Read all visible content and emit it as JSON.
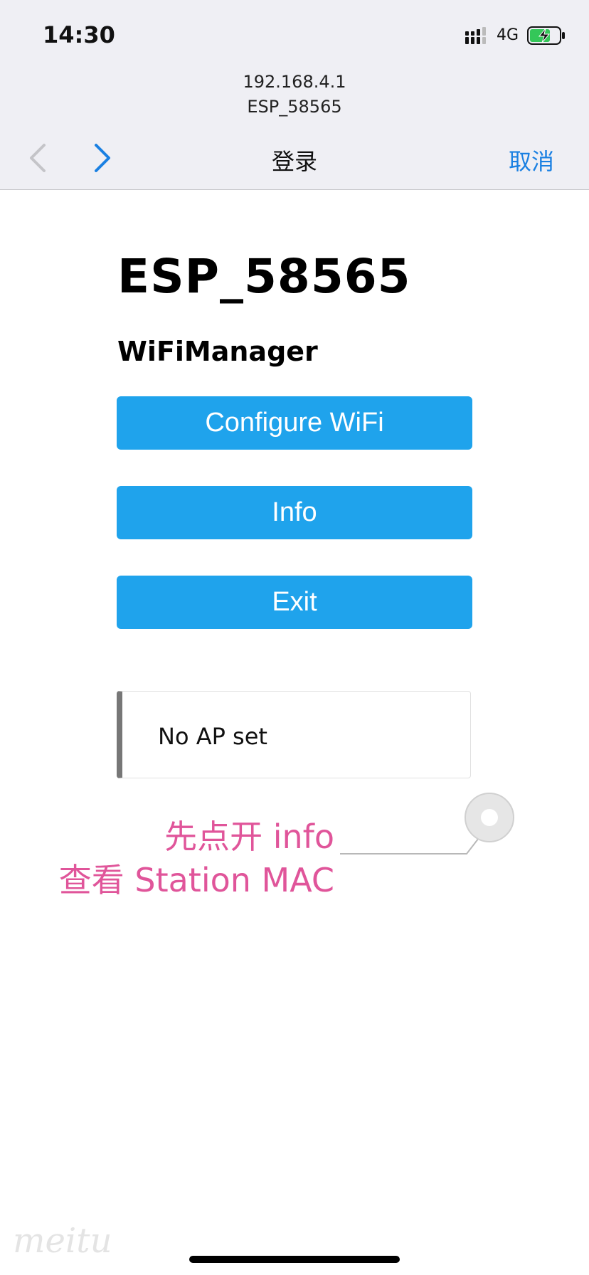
{
  "status_bar": {
    "time": "14:30",
    "network": "4G",
    "signal_icon": "cellular-signal-icon",
    "battery_icon": "battery-charging-icon"
  },
  "browser": {
    "address": "192.168.4.1",
    "network_name": "ESP_58565",
    "title": "登录",
    "cancel_label": "取消",
    "back_icon": "chevron-left-icon",
    "forward_icon": "chevron-right-icon"
  },
  "page": {
    "device_title": "ESP_58565",
    "subtitle": "WiFiManager",
    "buttons": {
      "configure_wifi": "Configure WiFi",
      "info": "Info",
      "exit": "Exit"
    },
    "message": "No AP set"
  },
  "annotation": {
    "line1": "先点开 info",
    "line2": "查看 Station MAC"
  },
  "watermark": "meitu",
  "colors": {
    "button_blue": "#1fa3ec",
    "accent_blue": "#1a80e2",
    "annotation_pink": "#e0559a"
  }
}
